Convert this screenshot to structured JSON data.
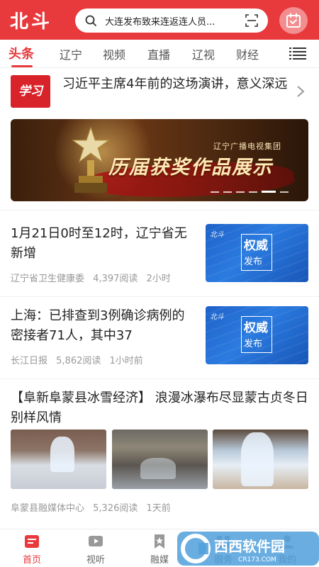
{
  "header": {
    "logo": "北斗",
    "search_text": "大连发布致来连返连人员...",
    "accent": "#e8393c"
  },
  "tabs": [
    {
      "label": "头条",
      "active": true
    },
    {
      "label": "辽宁"
    },
    {
      "label": "视频"
    },
    {
      "label": "直播"
    },
    {
      "label": "辽视"
    },
    {
      "label": "财经"
    }
  ],
  "feature": {
    "badge": "学习",
    "title": "习近平主席4年前的这场演讲，意义深远"
  },
  "banner": {
    "org": "辽宁广播电视集团",
    "title": "历届获奖作品展示",
    "slides": 6,
    "active_slide": 5
  },
  "news": [
    {
      "title": "1月21日0时至12时，辽宁省无新增",
      "source": "辽宁省卫生健康委",
      "reads": "4,397阅读",
      "time": "2小时",
      "thumb_logo": "北斗",
      "thumb_t1": "权威",
      "thumb_t2": "发布"
    },
    {
      "title": "上海：已排查到3例确诊病例的密接者71人，其中37",
      "source": "长江日报",
      "reads": "5,862阅读",
      "time": "1小时前",
      "thumb_logo": "北斗",
      "thumb_t1": "权威",
      "thumb_t2": "发布"
    }
  ],
  "gallery_news": {
    "title": "【阜新阜蒙县冰雪经济】 浪漫冰瀑布尽显蒙古贞冬日别样风情",
    "source": "阜蒙县融媒体中心",
    "reads": "5,326阅读",
    "time": "1天前"
  },
  "bottom_nav": [
    {
      "label": "首页",
      "icon": "home-icon",
      "active": true
    },
    {
      "label": "视听",
      "icon": "video-icon"
    },
    {
      "label": "融媒",
      "icon": "bookmark-icon"
    },
    {
      "label": "服务",
      "icon": "service-icon"
    },
    {
      "label": "我的",
      "icon": "user-icon"
    }
  ],
  "watermark": {
    "brand": "西西软件园",
    "url": "CR173.COM"
  }
}
